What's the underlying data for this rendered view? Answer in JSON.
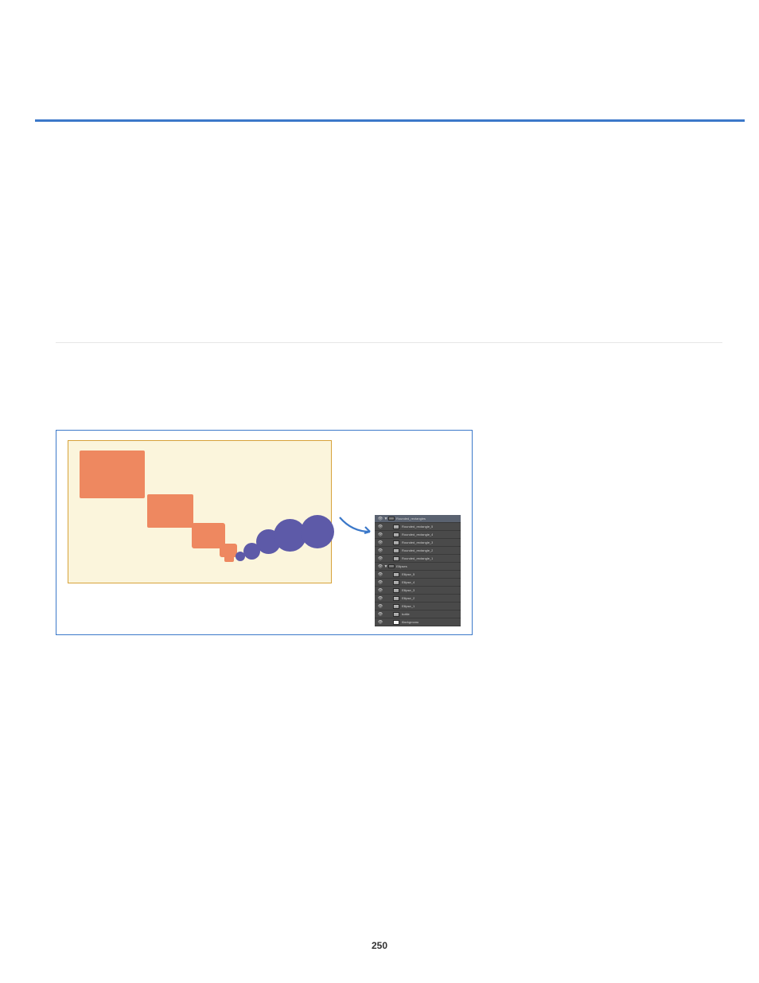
{
  "page": {
    "number": "250"
  },
  "figure": {
    "arrow_color": "#3b78c9"
  },
  "layers_panel": {
    "groups": [
      {
        "name": "Rounded_rectangles",
        "items": [
          "Rounded_rectangle_5",
          "Rounded_rectangle_4",
          "Rounded_rectangle_3",
          "Rounded_rectangle_2",
          "Rounded_rectangle_1"
        ]
      },
      {
        "name": "Ellipses",
        "items": [
          "Ellipse_5",
          "Ellipse_4",
          "Ellipse_3",
          "Ellipse_2",
          "Ellipse_1"
        ]
      }
    ],
    "other": [
      "bottle",
      "Background"
    ]
  }
}
